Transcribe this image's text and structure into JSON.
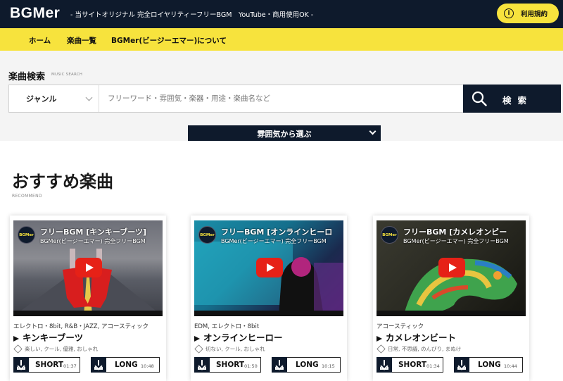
{
  "header": {
    "logo": "BGMer",
    "tagline": "- 当サイトオリジナル 完全ロイヤリティーフリーBGM　YouTube・商用使用OK -",
    "terms_label": "利用規約"
  },
  "nav": {
    "items": [
      {
        "label": "ホーム"
      },
      {
        "label": "楽曲一覧"
      },
      {
        "label": "BGMer(ビージーエマー)について"
      }
    ]
  },
  "search": {
    "title": "楽曲検索",
    "subtitle": "MUSIC SEARCH",
    "genre_label": "ジャンル",
    "placeholder": "フリーワード・雰囲気・楽器・用途・楽曲名など",
    "button_label": "検索"
  },
  "mood": {
    "label": "雰囲気から選ぶ"
  },
  "recommend": {
    "title": "おすすめ楽曲",
    "subtitle": "RECOMMEND",
    "cards": [
      {
        "channel": "BGMer",
        "video_title": "フリーBGM [キンキーブーツ]",
        "video_sub": "BGMer(ビージーエマー) 完全フリーBGM",
        "genres": "エレクトロ・8bit, R&B・JAZZ, アコースティック",
        "name": "キンキーブーツ",
        "tags": "楽しい, クール, 優雅, おしゃれ",
        "short_label": "SHORT",
        "short_time": "01:37",
        "long_label": "LONG",
        "long_time": "10:48"
      },
      {
        "channel": "BGMer",
        "video_title": "フリーBGM [オンラインヒーロ",
        "video_sub": "BGMer(ビージーエマー) 完全フリーBGM",
        "genres": "EDM, エレクトロ・8bit",
        "name": "オンラインヒーロー",
        "tags": "切ない, クール, おしゃれ",
        "short_label": "SHORT",
        "short_time": "01:50",
        "long_label": "LONG",
        "long_time": "10:15"
      },
      {
        "channel": "BGMer",
        "video_title": "フリーBGM [カメレオンビー",
        "video_sub": "BGMer(ビージーエマー) 完全フリーBGM",
        "genres": "アコースティック",
        "name": "カメレオンビート",
        "tags": "日常, 不思議, のんびり, まぬけ",
        "short_label": "SHORT",
        "short_time": "01:34",
        "long_label": "LONG",
        "long_time": "10:44"
      }
    ]
  },
  "colors": {
    "navy": "#0e1a2c",
    "yellow": "#f7e33d",
    "youtube_red": "#e62117"
  }
}
